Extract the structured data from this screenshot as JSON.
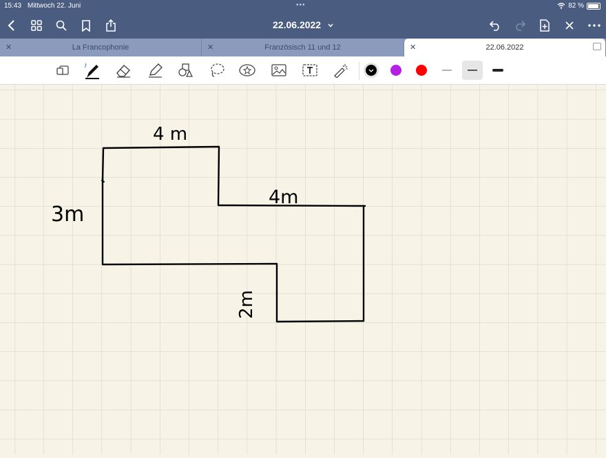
{
  "status": {
    "time": "15:43",
    "date": "Mittwoch 22. Juni",
    "battery": "82 %",
    "battery_level": 0.82
  },
  "nav": {
    "title": "22.06.2022"
  },
  "tabs": [
    {
      "label": "La Francophonie"
    },
    {
      "label": "Französisch 11 und 12"
    },
    {
      "label": "22.06.2022",
      "active": true
    }
  ],
  "toolbar": {
    "colors": [
      "#000000",
      "#b620e6",
      "#ff0000"
    ],
    "widths": [
      "thin",
      "medium",
      "thick"
    ]
  },
  "sketch": {
    "labels": {
      "top": "4 m",
      "middle": "4m",
      "left": "3m",
      "bottom": "2m"
    }
  }
}
